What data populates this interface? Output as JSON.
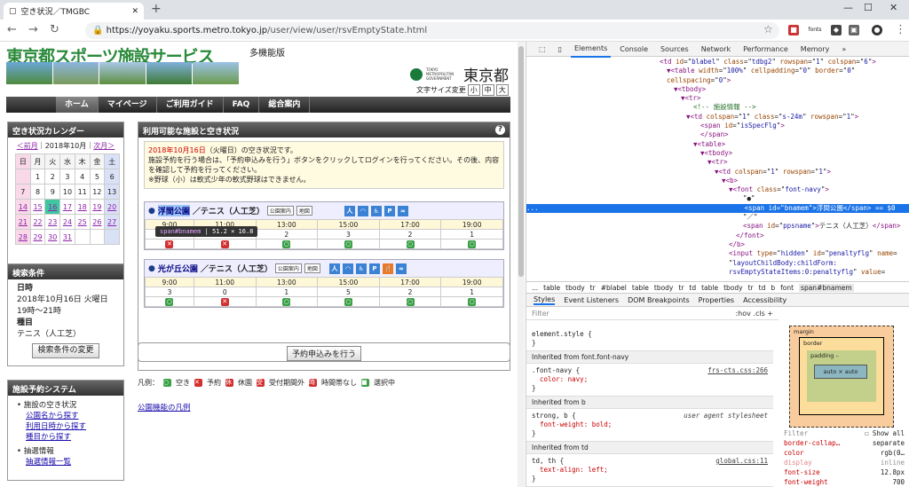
{
  "browser": {
    "tab_title": "空き状況／TMGBC",
    "new_tab": "+",
    "url_host": "https://yoyaku.sports.metro.tokyo.jp",
    "url_path": "/user/view/user/rsvEmptyState.html",
    "ext_label": "fonts"
  },
  "site": {
    "logo_text": "東京都スポーツ施設サービス",
    "multi_func": "多機能版",
    "tokyo_small": "TOKYO METROPOLITAN GOVERNMENT",
    "tokyo_big": "東京都",
    "font_size_label": "文字サイズ変更",
    "font_small": "小",
    "font_medium": "中",
    "font_large": "大",
    "menu": [
      "ホーム",
      "マイページ",
      "ご利用ガイド",
      "FAQ",
      "総合案内"
    ]
  },
  "calendar": {
    "title": "空き状況カレンダー",
    "prev": "＜前月",
    "month": "2018年10月",
    "next": "次月＞",
    "weekdays": [
      "日",
      "月",
      "火",
      "水",
      "木",
      "金",
      "土"
    ],
    "weeks": [
      [
        "",
        "1",
        "2",
        "3",
        "4",
        "5",
        "6"
      ],
      [
        "7",
        "8",
        "9",
        "10",
        "11",
        "12",
        "13"
      ],
      [
        "14",
        "15",
        "16",
        "17",
        "18",
        "19",
        "20"
      ],
      [
        "21",
        "22",
        "23",
        "24",
        "25",
        "26",
        "27"
      ],
      [
        "28",
        "29",
        "30",
        "31",
        "",
        "",
        ""
      ]
    ]
  },
  "conditions": {
    "title": "検索条件",
    "date_label": "日時",
    "date_value": "2018年10月16日 火曜日",
    "time_value": "19時～21時",
    "type_label": "種目",
    "type_value": "テニス（人工芝）",
    "change_button": "検索条件の変更"
  },
  "system": {
    "title": "施設予約システム",
    "item1": "施設の空き状況",
    "link1": "公園名から探す",
    "link2": "利用日時から探す",
    "link3": "種目から探す",
    "item2": "抽選情報",
    "link4": "抽選情報一覧"
  },
  "main": {
    "title": "利用可能な施設と空き状況",
    "help": "?",
    "notice_date": "2018年10月16日",
    "notice_text1": "（火曜日）の空き状況です。",
    "notice_text2": "施設予約を行う場合は、「予約申込みを行う」ボタンをクリックしてログインを行ってください。その後、内容を確認して予約を行ってください。",
    "notice_text3": "※野球（小）は軟式少年の軟式野球はできません。",
    "tooltip_tag": "span#bnamem",
    "tooltip_size": "51.2 × 16.8",
    "facilities": [
      {
        "park": "浮間公園",
        "court": "／テニス（人工芝）",
        "small1": "公園案内",
        "small2": "地図",
        "times": [
          "9:00",
          "11:00",
          "13:00",
          "15:00",
          "17:00",
          "19:00"
        ],
        "counts": [
          "0",
          "0",
          "2",
          "3",
          "2",
          "1"
        ],
        "marks": [
          "x",
          "x",
          "o",
          "o",
          "o",
          "o"
        ]
      },
      {
        "park": "光が丘公園",
        "court": "／テニス（人工芝）",
        "small1": "公園案内",
        "small2": "地図",
        "times": [
          "9:00",
          "11:00",
          "13:00",
          "15:00",
          "17:00",
          "19:00"
        ],
        "counts": [
          "3",
          "0",
          "1",
          "5",
          "2",
          "1"
        ],
        "marks": [
          "o",
          "x",
          "o",
          "o",
          "o",
          "o"
        ]
      }
    ],
    "apply_button": "予約申込みを行う",
    "legend_label": "凡例：",
    "legend": [
      "空き",
      "予約",
      "休園",
      "受付期間外",
      "時間帯なし",
      "選択中"
    ],
    "legend_link": "公園機能の凡例"
  },
  "devtools": {
    "tabs": [
      "Elements",
      "Console",
      "Sources",
      "Network",
      "Performance",
      "Memory",
      "»"
    ],
    "crumbs": [
      "...",
      "table",
      "tbody",
      "tr",
      "#blabel",
      "table",
      "tbody",
      "tr",
      "td",
      "table",
      "tbody",
      "tr",
      "td",
      "b",
      "font",
      "span#bnamem"
    ],
    "style_tabs": [
      "Styles",
      "Event Listeners",
      "DOM Breakpoints",
      "Properties",
      "Accessibility"
    ],
    "filter": "Filter",
    "hov": ":hov .cls +",
    "inherited1": "Inherited from font.font-navy",
    "rule1_sel": ".font-navy {",
    "rule1_src": "frs-cts.css:266",
    "rule1_prop": "color: navy;",
    "inherited2": "Inherited from b",
    "rule2_sel": "strong, b {",
    "rule2_src": "user agent stylesheet",
    "rule2_prop": "font-weight: bold;",
    "inherited3": "Inherited from td",
    "rule3_sel": "td, th {",
    "rule3_src": "global.css:11",
    "rule3_prop": "text-align: left;",
    "element_style": "element.style {",
    "bm_margin": "margin",
    "bm_border": "border",
    "bm_padding": "padding –",
    "bm_content": "auto × auto",
    "show_all": "Show all",
    "computed": [
      [
        "border-collap…",
        "separate"
      ],
      [
        "color",
        "rgb(0…"
      ],
      [
        "display",
        "inline"
      ],
      [
        "font-size",
        "12.8px"
      ],
      [
        "font-weight",
        "700"
      ]
    ]
  }
}
